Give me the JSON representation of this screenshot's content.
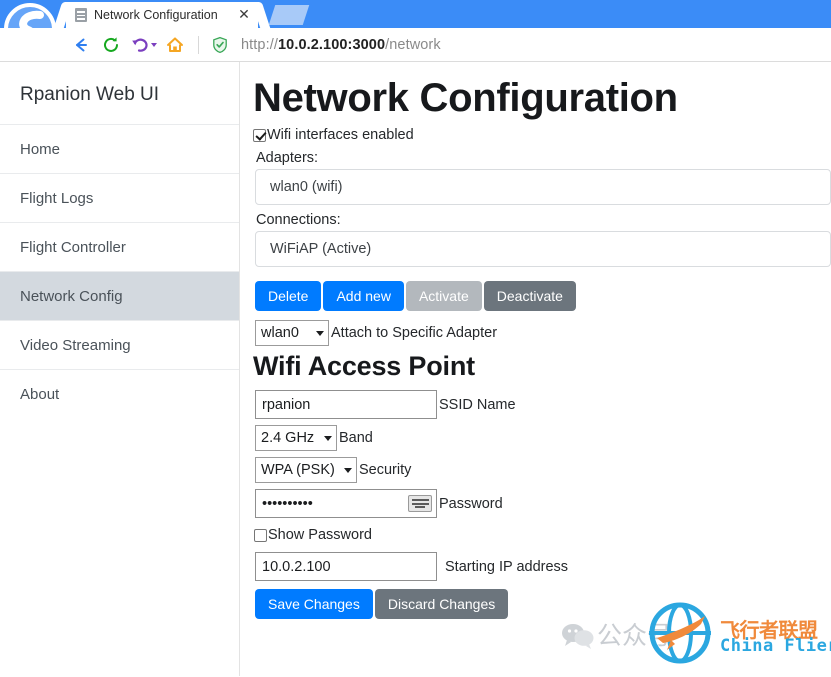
{
  "browser": {
    "logo_icon": "sogou-s-logo-icon",
    "tab": {
      "favicon": "document-icon",
      "title": "Network Configuration",
      "close_label": "✕"
    },
    "new_tab_label": "",
    "nav": {
      "back_icon": "back-arrow-icon",
      "reload_icon": "reload-icon",
      "history_icon": "undo-history-icon",
      "home_icon": "home-icon",
      "shield_icon": "security-shield-icon"
    },
    "url": {
      "scheme": "http://",
      "host": "10.0.2.100:3000",
      "path": "/network"
    }
  },
  "sidebar": {
    "title": "Rpanion Web UI",
    "items": [
      {
        "label": "Home",
        "active": false
      },
      {
        "label": "Flight Logs",
        "active": false
      },
      {
        "label": "Flight Controller",
        "active": false
      },
      {
        "label": "Network Config",
        "active": true
      },
      {
        "label": "Video Streaming",
        "active": false
      },
      {
        "label": "About",
        "active": false
      }
    ]
  },
  "main": {
    "page_title": "Network Configuration",
    "wifi_enabled_label": "Wifi interfaces enabled",
    "wifi_enabled_checked": true,
    "adapters_label": "Adapters:",
    "adapters_selected": "wlan0 (wifi)",
    "connections_label": "Connections:",
    "connections_selected": "WiFiAP (Active)",
    "buttons": {
      "delete": "Delete",
      "add_new": "Add new",
      "activate": "Activate",
      "deactivate": "Deactivate"
    },
    "attach_adapter": {
      "value": "wlan0",
      "label": "Attach to Specific Adapter"
    },
    "ap_section_title": "Wifi Access Point",
    "ssid": {
      "value": "rpanion",
      "label": "SSID Name"
    },
    "band": {
      "value": "2.4 GHz",
      "label": "Band"
    },
    "security": {
      "value": "WPA (PSK)",
      "label": "Security"
    },
    "password": {
      "value": "••••••••••",
      "label": "Password",
      "keyboard_icon": "virtual-keyboard-icon"
    },
    "show_password": {
      "label": "Show Password",
      "checked": false
    },
    "starting_ip": {
      "value": "10.0.2.100",
      "label": "Starting IP address"
    },
    "save_label": "Save Changes",
    "discard_label": "Discard Changes"
  },
  "watermark": {
    "wechat_icon": "wechat-icon",
    "cn_text": "公众号",
    "brand_cn": "飞行者联盟",
    "brand_en": "China Flier",
    "plane_icon": "airplane-globe-icon"
  },
  "colors": {
    "accent_blue": "#007bff",
    "chrome_blue": "#3b8cf7",
    "secondary_gray": "#6c757d",
    "disabled_gray": "#b3b8bd",
    "sidebar_active": "#d3d9df"
  }
}
